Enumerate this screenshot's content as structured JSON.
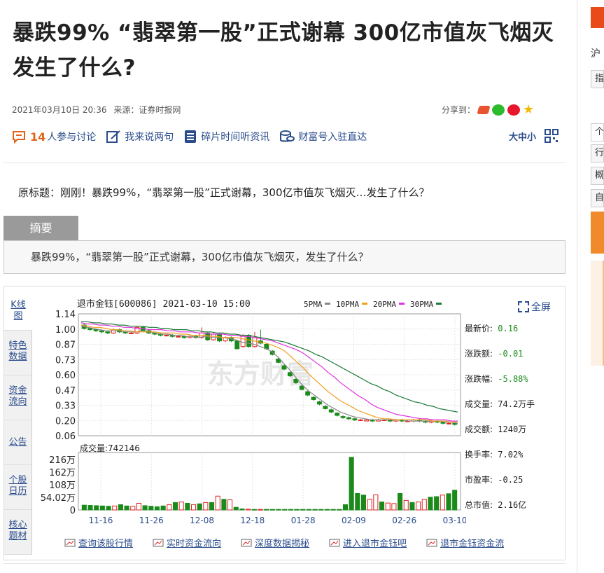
{
  "article": {
    "title": "暴跌99% “翡翠第一股”正式谢幕 300亿市值灰飞烟灭 发生了什么?",
    "date": "2021年03月10日 20:36",
    "source": "来源：证券时报网",
    "share_label": "分享到："
  },
  "toolbar": {
    "comment_count": "14",
    "comment_label": "人参与讨论",
    "say_label": "我来说两句",
    "listen_label": "碎片时间听资讯",
    "fortune_label": "财富号入驻直达",
    "font_size_label": "大中小"
  },
  "original_title": "原标题：刚刚！暴跌99%，“翡翠第一股”正式谢幕，300亿市值灰飞烟灭…发生了什么？",
  "abstract": {
    "tab_label": "摘要",
    "text": "暴跌99%，“翡翠第一股”正式谢幕，300亿市值灰飞烟灭，发生了什么？"
  },
  "quote_widget": {
    "tabs": [
      "K线图",
      "特色数据",
      "资金流向",
      "公告",
      "个股日历",
      "核心题材"
    ],
    "fullscreen_label": "全屏",
    "header": "退市金钰[600086] 2021-03-10 15:00",
    "ma_labels": [
      "5PMA",
      "10PMA",
      "20PMA",
      "30PMA"
    ],
    "ma_colors": [
      "#888888",
      "#f0a020",
      "#e030e0",
      "#1a7a3a"
    ],
    "watermark": "东方财富",
    "volume_label": "成交量:742146",
    "stats": [
      {
        "label": "最新价:",
        "value": "0.16",
        "color": "#1a8a1a"
      },
      {
        "label": "涨跌额:",
        "value": "-0.01",
        "color": "#1a8a1a"
      },
      {
        "label": "涨跌幅:",
        "value": "-5.88%",
        "color": "#1a8a1a"
      },
      {
        "label": "成交量:",
        "value": "74.2万手",
        "color": "#222"
      },
      {
        "label": "成交额:",
        "value": "1240万",
        "color": "#222"
      },
      {
        "label": "换手率:",
        "value": "7.02%",
        "color": "#222"
      },
      {
        "label": "市盈率:",
        "value": "-0.25",
        "color": "#222"
      },
      {
        "label": "总市值:",
        "value": "2.16亿",
        "color": "#222"
      }
    ],
    "links": [
      "查询该股行情",
      "实时资金流向",
      "深度数据揭秘",
      "进入退市金钰吧",
      "退市金钰资金流"
    ]
  },
  "right_panel": {
    "items": [
      "沪",
      "指",
      "个",
      "行",
      "概",
      "自"
    ]
  },
  "chart_data": {
    "type": "candlestick",
    "price_ticks": [
      "1.14",
      "1.00",
      "0.87",
      "0.73",
      "0.60",
      "0.47",
      "0.33",
      "0.20",
      "0.06"
    ],
    "volume_ticks": [
      "216万",
      "162万",
      "108万",
      "54.02万",
      "0"
    ],
    "x_labels": [
      "11-16",
      "11-26",
      "12-08",
      "12-18",
      "01-28",
      "02-09",
      "02-26",
      "03-10"
    ],
    "ylim_price": [
      0.06,
      1.14
    ],
    "ylim_volume": [
      0,
      2160000
    ],
    "candles": [
      {
        "o": 1.04,
        "c": 1.01,
        "h": 1.05,
        "l": 1.0
      },
      {
        "o": 1.01,
        "c": 1.0,
        "h": 1.02,
        "l": 0.99
      },
      {
        "o": 1.0,
        "c": 0.99,
        "h": 1.01,
        "l": 0.98
      },
      {
        "o": 0.99,
        "c": 0.98,
        "h": 1.0,
        "l": 0.97
      },
      {
        "o": 0.98,
        "c": 0.97,
        "h": 0.99,
        "l": 0.96
      },
      {
        "o": 0.97,
        "c": 1.0,
        "h": 1.01,
        "l": 0.96
      },
      {
        "o": 1.0,
        "c": 0.98,
        "h": 1.01,
        "l": 0.97
      },
      {
        "o": 0.98,
        "c": 0.97,
        "h": 0.99,
        "l": 0.96
      },
      {
        "o": 0.97,
        "c": 0.97,
        "h": 0.98,
        "l": 0.96
      },
      {
        "o": 0.97,
        "c": 1.02,
        "h": 1.03,
        "l": 0.96
      },
      {
        "o": 1.02,
        "c": 0.99,
        "h": 1.03,
        "l": 0.98
      },
      {
        "o": 0.99,
        "c": 0.97,
        "h": 1.0,
        "l": 0.96
      },
      {
        "o": 0.97,
        "c": 0.96,
        "h": 0.98,
        "l": 0.95
      },
      {
        "o": 0.96,
        "c": 0.95,
        "h": 0.97,
        "l": 0.94
      },
      {
        "o": 0.95,
        "c": 0.95,
        "h": 0.96,
        "l": 0.94
      },
      {
        "o": 0.95,
        "c": 0.94,
        "h": 0.96,
        "l": 0.93
      },
      {
        "o": 0.94,
        "c": 0.94,
        "h": 0.95,
        "l": 0.93
      },
      {
        "o": 0.94,
        "c": 0.93,
        "h": 0.95,
        "l": 0.92
      },
      {
        "o": 0.93,
        "c": 0.94,
        "h": 0.95,
        "l": 0.92
      },
      {
        "o": 0.94,
        "c": 0.93,
        "h": 0.95,
        "l": 0.92
      },
      {
        "o": 0.93,
        "c": 0.97,
        "h": 1.02,
        "l": 0.92
      },
      {
        "o": 0.97,
        "c": 0.91,
        "h": 0.98,
        "l": 0.9
      },
      {
        "o": 0.91,
        "c": 0.96,
        "h": 0.97,
        "l": 0.9
      },
      {
        "o": 0.96,
        "c": 0.9,
        "h": 0.97,
        "l": 0.89
      },
      {
        "o": 0.9,
        "c": 0.93,
        "h": 0.94,
        "l": 0.89
      },
      {
        "o": 0.93,
        "c": 0.9,
        "h": 0.94,
        "l": 0.89
      },
      {
        "o": 0.9,
        "c": 0.83,
        "h": 0.91,
        "l": 0.83
      },
      {
        "o": 0.85,
        "c": 0.95,
        "h": 0.96,
        "l": 0.84
      },
      {
        "o": 0.95,
        "c": 0.85,
        "h": 0.96,
        "l": 0.84
      },
      {
        "o": 0.85,
        "c": 0.93,
        "h": 0.98,
        "l": 0.84
      },
      {
        "o": 0.9,
        "c": 0.88,
        "h": 1.0,
        "l": 0.87
      },
      {
        "o": 0.87,
        "c": 0.83,
        "h": 0.88,
        "l": 0.82
      },
      {
        "o": 0.81,
        "c": 0.78,
        "h": 0.82,
        "l": 0.77
      },
      {
        "o": 0.74,
        "c": 0.71,
        "h": 0.75,
        "l": 0.7
      },
      {
        "o": 0.68,
        "c": 0.65,
        "h": 0.69,
        "l": 0.64
      },
      {
        "o": 0.62,
        "c": 0.59,
        "h": 0.63,
        "l": 0.58
      },
      {
        "o": 0.56,
        "c": 0.53,
        "h": 0.57,
        "l": 0.52
      },
      {
        "o": 0.5,
        "c": 0.47,
        "h": 0.51,
        "l": 0.46
      },
      {
        "o": 0.45,
        "c": 0.42,
        "h": 0.46,
        "l": 0.41
      },
      {
        "o": 0.4,
        "c": 0.38,
        "h": 0.41,
        "l": 0.37
      },
      {
        "o": 0.36,
        "c": 0.34,
        "h": 0.37,
        "l": 0.33
      },
      {
        "o": 0.32,
        "c": 0.3,
        "h": 0.33,
        "l": 0.29
      },
      {
        "o": 0.29,
        "c": 0.27,
        "h": 0.3,
        "l": 0.26
      },
      {
        "o": 0.26,
        "c": 0.24,
        "h": 0.27,
        "l": 0.23
      },
      {
        "o": 0.23,
        "c": 0.22,
        "h": 0.24,
        "l": 0.21
      },
      {
        "o": 0.22,
        "c": 0.21,
        "h": 0.23,
        "l": 0.2
      },
      {
        "o": 0.21,
        "c": 0.2,
        "h": 0.22,
        "l": 0.19
      },
      {
        "o": 0.2,
        "c": 0.2,
        "h": 0.21,
        "l": 0.19
      },
      {
        "o": 0.19,
        "c": 0.2,
        "h": 0.21,
        "l": 0.19
      },
      {
        "o": 0.2,
        "c": 0.19,
        "h": 0.21,
        "l": 0.18
      },
      {
        "o": 0.19,
        "c": 0.2,
        "h": 0.21,
        "l": 0.19
      },
      {
        "o": 0.2,
        "c": 0.2,
        "h": 0.21,
        "l": 0.19
      },
      {
        "o": 0.2,
        "c": 0.19,
        "h": 0.21,
        "l": 0.18
      },
      {
        "o": 0.19,
        "c": 0.2,
        "h": 0.21,
        "l": 0.18
      },
      {
        "o": 0.2,
        "c": 0.19,
        "h": 0.21,
        "l": 0.18
      },
      {
        "o": 0.19,
        "c": 0.19,
        "h": 0.2,
        "l": 0.18
      },
      {
        "o": 0.19,
        "c": 0.2,
        "h": 0.21,
        "l": 0.18
      },
      {
        "o": 0.2,
        "c": 0.19,
        "h": 0.21,
        "l": 0.18
      },
      {
        "o": 0.19,
        "c": 0.18,
        "h": 0.2,
        "l": 0.17
      },
      {
        "o": 0.18,
        "c": 0.19,
        "h": 0.2,
        "l": 0.17
      },
      {
        "o": 0.19,
        "c": 0.18,
        "h": 0.2,
        "l": 0.17
      },
      {
        "o": 0.18,
        "c": 0.17,
        "h": 0.19,
        "l": 0.16
      },
      {
        "o": 0.17,
        "c": 0.17,
        "h": 0.18,
        "l": 0.16
      },
      {
        "o": 0.17,
        "c": 0.16,
        "h": 0.18,
        "l": 0.15
      }
    ],
    "volumes": [
      180000,
      170000,
      160000,
      150000,
      140000,
      150000,
      200000,
      150000,
      130000,
      250000,
      160000,
      140000,
      120000,
      150000,
      200000,
      280000,
      300000,
      250000,
      200000,
      230000,
      280000,
      280000,
      520000,
      400000,
      380000,
      100000,
      40000,
      30000,
      20000,
      20000,
      20000,
      20000,
      20000,
      20000,
      20000,
      20000,
      20000,
      20000,
      20000,
      20000,
      20000,
      20000,
      20000,
      200000,
      1980000,
      620000,
      560000,
      400000,
      570000,
      300000,
      260000,
      240000,
      620000,
      360000,
      280000,
      300000,
      400000,
      480000,
      500000,
      560000,
      610000,
      742146
    ],
    "ma5": [
      1.03,
      1.02,
      1.01,
      1.0,
      0.99,
      0.99,
      0.99,
      0.98,
      0.98,
      0.98,
      0.99,
      0.98,
      0.97,
      0.96,
      0.96,
      0.95,
      0.95,
      0.94,
      0.94,
      0.93,
      0.94,
      0.93,
      0.93,
      0.93,
      0.92,
      0.91,
      0.89,
      0.88,
      0.87,
      0.85,
      0.83,
      0.8,
      0.75,
      0.69,
      0.63,
      0.56,
      0.5,
      0.45,
      0.41,
      0.37,
      0.33,
      0.3,
      0.27,
      0.25,
      0.23,
      0.22,
      0.21,
      0.2,
      0.2,
      0.2,
      0.2,
      0.2,
      0.2,
      0.19,
      0.19,
      0.19,
      0.19,
      0.19,
      0.19,
      0.18,
      0.18,
      0.17
    ],
    "ma10": [
      1.04,
      1.03,
      1.02,
      1.02,
      1.01,
      1.0,
      1.0,
      0.99,
      0.99,
      0.98,
      0.98,
      0.98,
      0.98,
      0.97,
      0.97,
      0.97,
      0.96,
      0.96,
      0.95,
      0.95,
      0.95,
      0.94,
      0.94,
      0.93,
      0.93,
      0.93,
      0.92,
      0.91,
      0.9,
      0.89,
      0.88,
      0.86,
      0.84,
      0.81,
      0.76,
      0.71,
      0.66,
      0.6,
      0.55,
      0.5,
      0.45,
      0.41,
      0.37,
      0.34,
      0.31,
      0.28,
      0.26,
      0.24,
      0.22,
      0.21,
      0.21,
      0.2,
      0.2,
      0.2,
      0.2,
      0.2,
      0.2,
      0.19,
      0.19,
      0.19,
      0.18,
      0.18
    ],
    "ma20": [
      1.06,
      1.05,
      1.05,
      1.04,
      1.04,
      1.03,
      1.03,
      1.02,
      1.02,
      1.01,
      1.01,
      1.0,
      1.0,
      1.0,
      0.99,
      0.99,
      0.98,
      0.98,
      0.98,
      0.97,
      0.97,
      0.96,
      0.96,
      0.96,
      0.95,
      0.95,
      0.94,
      0.94,
      0.93,
      0.92,
      0.91,
      0.9,
      0.88,
      0.86,
      0.84,
      0.82,
      0.79,
      0.75,
      0.71,
      0.67,
      0.62,
      0.58,
      0.53,
      0.49,
      0.45,
      0.41,
      0.38,
      0.34,
      0.31,
      0.29,
      0.27,
      0.25,
      0.24,
      0.23,
      0.22,
      0.21,
      0.21,
      0.2,
      0.2,
      0.2,
      0.19,
      0.19
    ],
    "ma30": [
      1.07,
      1.07,
      1.06,
      1.06,
      1.05,
      1.05,
      1.04,
      1.04,
      1.03,
      1.03,
      1.03,
      1.02,
      1.02,
      1.01,
      1.01,
      1.0,
      1.0,
      1.0,
      0.99,
      0.99,
      0.98,
      0.98,
      0.97,
      0.97,
      0.96,
      0.96,
      0.95,
      0.95,
      0.94,
      0.93,
      0.92,
      0.91,
      0.9,
      0.89,
      0.87,
      0.85,
      0.83,
      0.81,
      0.78,
      0.76,
      0.73,
      0.7,
      0.67,
      0.64,
      0.61,
      0.58,
      0.55,
      0.52,
      0.5,
      0.47,
      0.45,
      0.42,
      0.4,
      0.38,
      0.36,
      0.35,
      0.33,
      0.32,
      0.3,
      0.29,
      0.28,
      0.27
    ]
  }
}
